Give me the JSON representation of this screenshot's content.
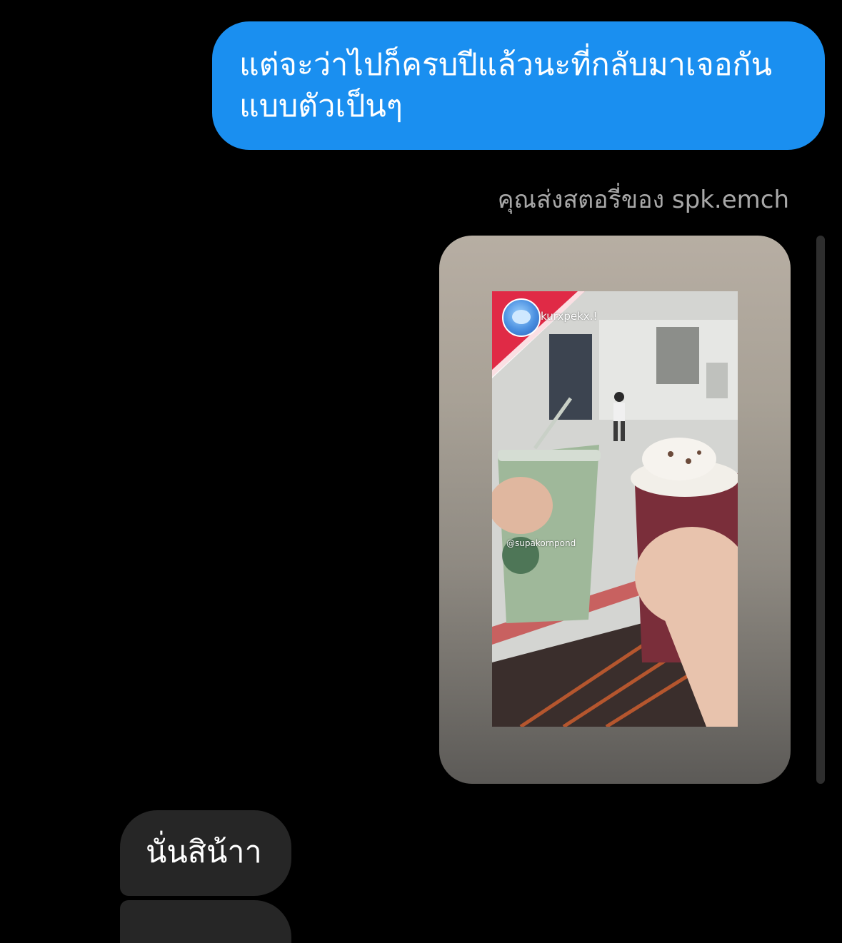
{
  "messages": {
    "outgoing_text": "แต่จะว่าไปก็ครบปีแล้วนะที่กลับมาเจอกัน แบบตัวเป็นๆ",
    "story_caption": "คุณส่งสตอรี่ของ spk.emch",
    "incoming_text": "นั่นสิน้าา"
  },
  "story": {
    "overlay_username": "kurxpekx.!",
    "overlay_tag": "@supakornpond"
  },
  "colors": {
    "outgoing_bubble": "#1a8ff0",
    "incoming_bubble": "#262626",
    "caption_text": "#a8a8a8",
    "background": "#000000"
  }
}
